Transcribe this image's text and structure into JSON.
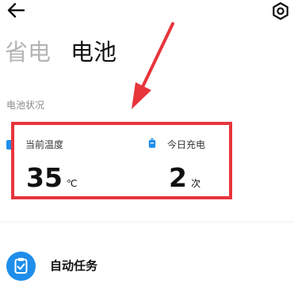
{
  "tabs": [
    {
      "label": "省电"
    },
    {
      "label": "电池"
    }
  ],
  "battery_status": {
    "section_title": "电池状况",
    "temperature": {
      "label": "当前温度",
      "value": "35",
      "unit": "℃"
    },
    "charge_count": {
      "label": "今日充电",
      "value": "2",
      "unit": "次"
    }
  },
  "task_item": {
    "label": "自动任务"
  },
  "icons": {
    "back": "back-arrow-icon",
    "settings": "gear-icon",
    "temperature": "thermometer-icon",
    "charge": "battery-icon",
    "task": "clipboard-check-icon"
  },
  "colors": {
    "highlight": "#e8343b",
    "accent": "#1f8eea",
    "inactive_tab": "#b4b4b4"
  }
}
